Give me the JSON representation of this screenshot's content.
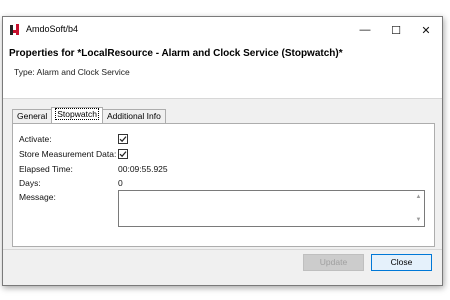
{
  "window": {
    "title": "AmdoSoft/b4",
    "controls": {
      "minimize": "—",
      "maximize": "☐",
      "close": "✕"
    }
  },
  "header": {
    "title": "Properties for *LocalResource - Alarm and Clock Service (Stopwatch)*",
    "type_line": "Type: Alarm and Clock Service"
  },
  "tabs": [
    {
      "label": "General",
      "active": false
    },
    {
      "label": "Stopwatch",
      "active": true
    },
    {
      "label": "Additional Info",
      "active": false
    }
  ],
  "fields": {
    "activate_label": "Activate:",
    "activate_checked": true,
    "store_label": "Store Measurement Data:",
    "store_checked": true,
    "elapsed_label": "Elapsed Time:",
    "elapsed_value": "00:09:55.925",
    "days_label": "Days:",
    "days_value": "0",
    "message_label": "Message:",
    "message_value": ""
  },
  "buttons": {
    "update_label": "Update",
    "update_enabled": false,
    "close_label": "Close"
  },
  "icons": {
    "app": "app-logo-icon",
    "check": "checkmark-icon",
    "scroll_up": "scroll-up-icon",
    "scroll_down": "scroll-down-icon"
  },
  "colors": {
    "accent_focus": "#0078d7",
    "dialog_bg": "#f0f0f0",
    "app_icon": "#c8102e"
  }
}
